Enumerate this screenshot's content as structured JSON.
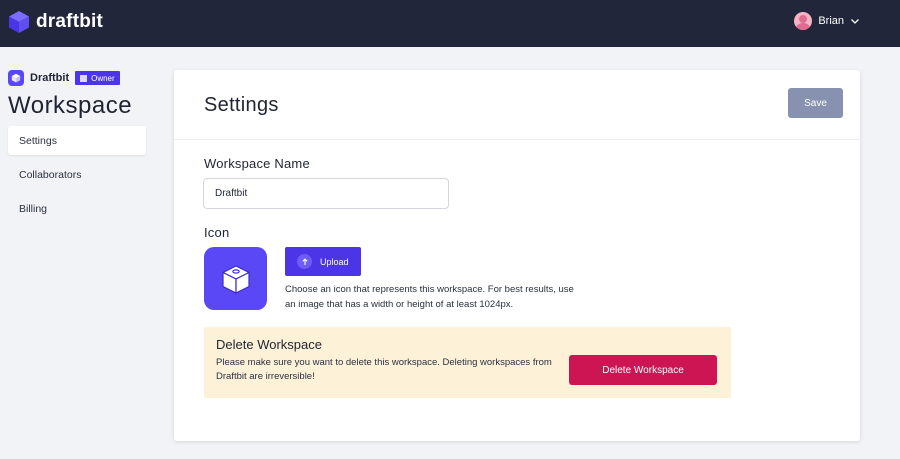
{
  "topbar": {
    "brand_name": "draftbit",
    "brand_icon": "cube-icon",
    "user_name": "Brian",
    "colors": {
      "bg": "#21263a"
    }
  },
  "sidebar": {
    "workspace_name": "Draftbit",
    "role_badge": "Owner",
    "title": "Workspace",
    "items": [
      {
        "label": "Settings",
        "active": true
      },
      {
        "label": "Collaborators",
        "active": false
      },
      {
        "label": "Billing",
        "active": false
      }
    ]
  },
  "settings": {
    "title": "Settings",
    "save_label": "Save",
    "workspace_name_label": "Workspace Name",
    "workspace_name_value": "Draftbit",
    "icon_label": "Icon",
    "upload_label": "Upload",
    "icon_help": "Choose an icon that represents this workspace. For best results, use an image that has a width or height of at least 1024px."
  },
  "danger_zone": {
    "title": "Delete Workspace",
    "text": "Please make sure you want to delete this workspace. Deleting workspaces from Draftbit are irreversible!",
    "button_label": "Delete Workspace"
  },
  "colors": {
    "accent": "#5a47f5",
    "badge": "#4c35e6",
    "danger_button": "#cc1552",
    "danger_bg": "#fdf1d8",
    "save_button": "#8792b0"
  }
}
